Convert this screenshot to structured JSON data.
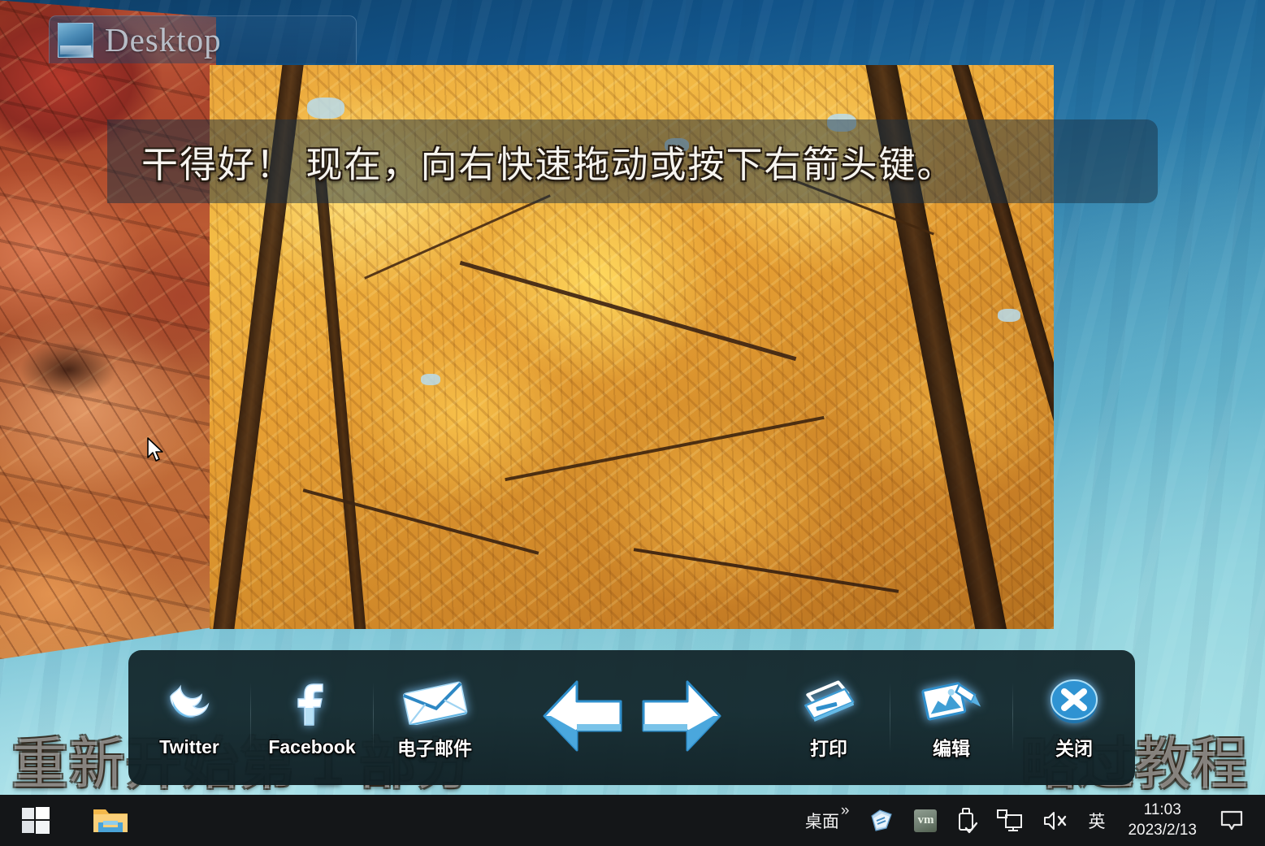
{
  "window": {
    "title": "Desktop",
    "icon": "picture-icon"
  },
  "instruction": {
    "text": "干得好！  现在，向右快速拖动或按下右箭头键。"
  },
  "background_overlay": {
    "restart_part_text": "重新开始第 1 部分",
    "skip_tutorial_text": "略过教程"
  },
  "toolbar": {
    "share_buttons": [
      {
        "label": "Twitter",
        "icon": "twitter-bird-icon"
      },
      {
        "label": "Facebook",
        "icon": "facebook-f-icon"
      },
      {
        "label": "电子邮件",
        "icon": "email-envelope-icon"
      }
    ],
    "nav_buttons": [
      {
        "name": "previous",
        "icon": "arrow-left-icon"
      },
      {
        "name": "next",
        "icon": "arrow-right-icon"
      }
    ],
    "action_buttons": [
      {
        "label": "打印",
        "icon": "printer-icon"
      },
      {
        "label": "编辑",
        "icon": "edit-image-icon"
      },
      {
        "label": "关闭",
        "icon": "close-circle-icon"
      }
    ]
  },
  "taskbar": {
    "start_label": "start-button",
    "explorer_label": "file-explorer",
    "tray": {
      "desktop_label": "桌面",
      "overflow_chevron": "»",
      "input_method": "英",
      "time": "11:03",
      "date": "2023/2/13",
      "vm_label": "vm"
    }
  },
  "colors": {
    "accent_blue": "#2f9fe0",
    "toolbar_bg": "#15292e",
    "taskbar_bg": "#141618",
    "banner_bg": "#1a3042",
    "photo_gold": "#e8a134",
    "leaves_red": "#a8432a"
  }
}
